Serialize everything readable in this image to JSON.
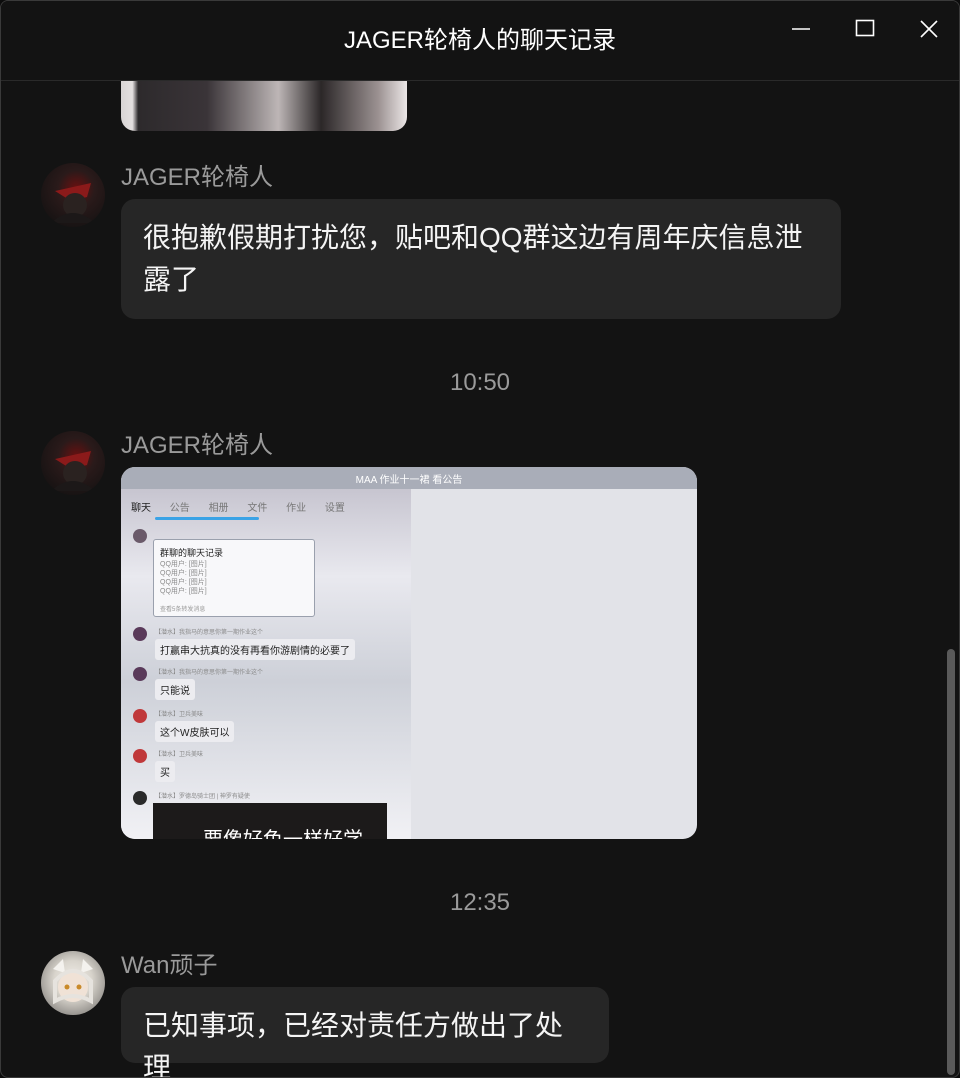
{
  "window": {
    "title": "JAGER轮椅人的聊天记录",
    "controls": [
      "minimize-icon",
      "maximize-icon",
      "close-icon"
    ]
  },
  "messages": [
    {
      "sender": "JAGER轮椅人",
      "text": "很抱歉假期打扰您，贴吧和QQ群这边有周年庆信息泄露了"
    },
    {
      "timestamp": "10:50"
    },
    {
      "sender": "JAGER轮椅人",
      "image": {
        "title": "MAA 作业十一裙 看公告",
        "tabs": [
          "聊天",
          "公告",
          "相册",
          "文件",
          "作业",
          "设置"
        ],
        "card_title": "群聊的聊天记录",
        "card_lines": [
          "QQ用户: [图片]",
          "QQ用户: [图片]",
          "QQ用户: [图片]",
          "QQ用户: [图片]"
        ],
        "card_footer": "查看5条转发消息",
        "chat_messages": [
          {
            "meta": "【潜水】我指马的意思你第一期作业这个",
            "text": "打赢串大抗真的没有再看你游剧情的必要了"
          },
          {
            "meta": "【潜水】我指马的意思你第一期作业这个",
            "text": "只能说"
          },
          {
            "meta": "【潜水】卫兵美味",
            "text": "这个W皮肤可以"
          },
          {
            "meta": "【潜水】卫兵美味",
            "text": "买"
          },
          {
            "meta": "【潜水】罗德岛骑士团 | 神罗有疑使",
            "text": "要像好色一样好学"
          }
        ]
      }
    },
    {
      "timestamp": "12:35"
    },
    {
      "sender": "Wan顽子",
      "text": "已知事项，已经对责任方做出了处理"
    }
  ]
}
